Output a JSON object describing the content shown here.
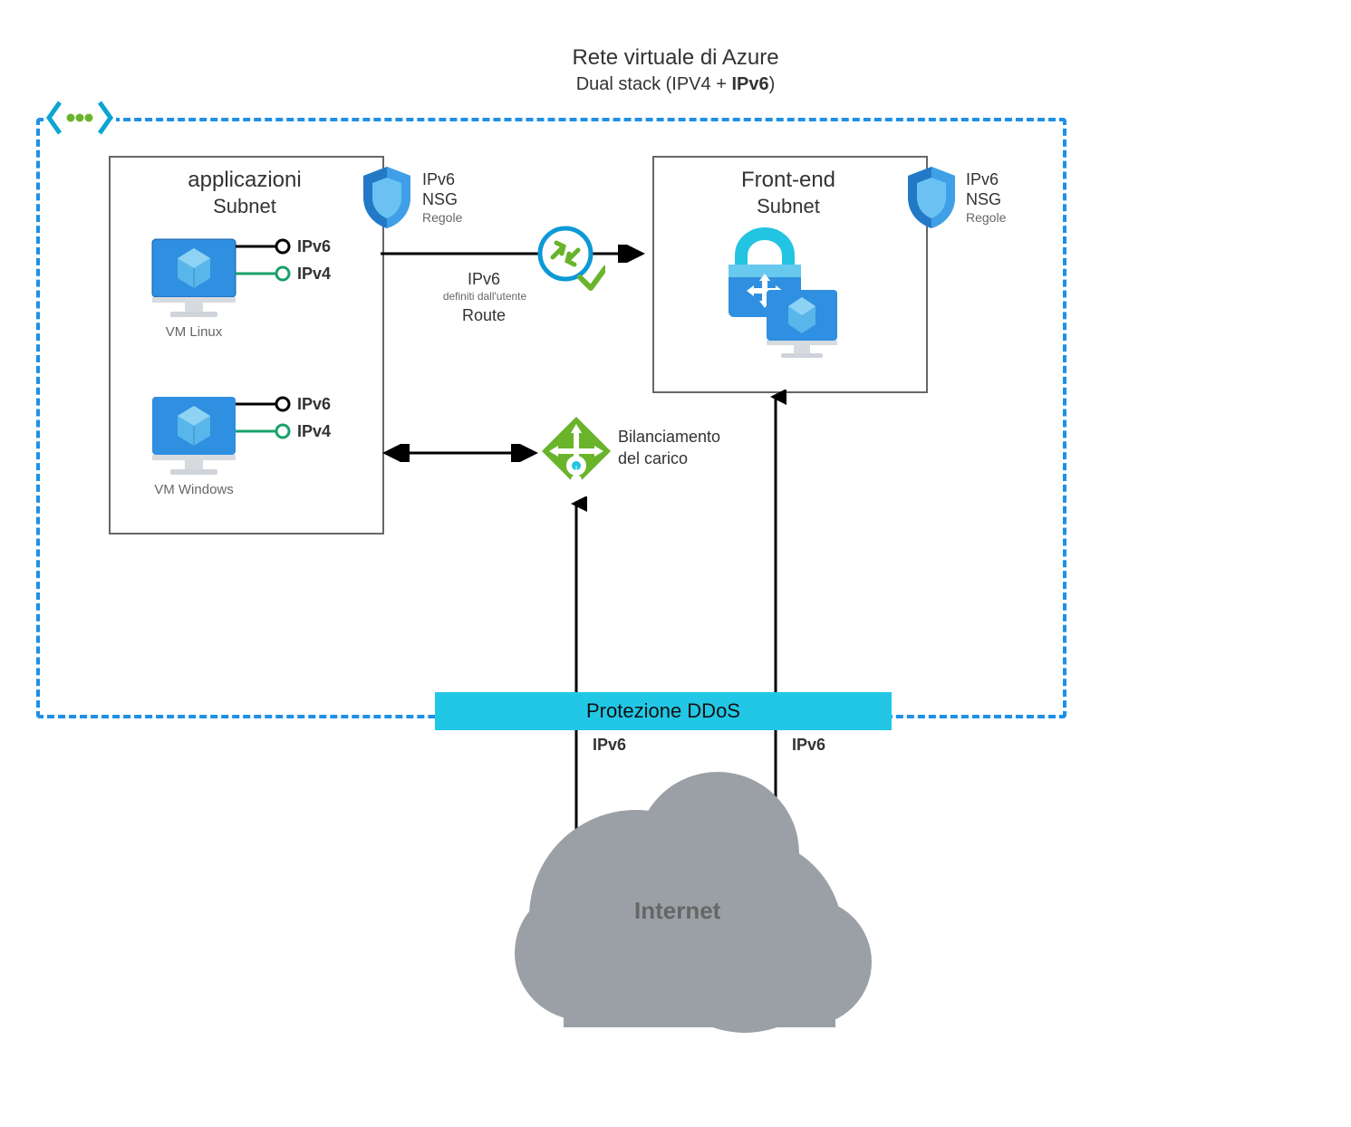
{
  "title": {
    "main": "Rete virtuale di Azure",
    "sub_prefix": "Dual stack (IPV4 + ",
    "sub_ipv6": "IPv6",
    "sub_suffix": ")"
  },
  "applications_subnet": {
    "title_line1": "applicazioni",
    "title_line2": "Subnet",
    "vm_linux": {
      "caption": "VM Linux",
      "ipv6": "IPv6",
      "ipv4": "IPv4"
    },
    "vm_windows": {
      "caption": "VM Windows",
      "ipv6": "IPv6",
      "ipv4": "IPv4"
    },
    "nsg": {
      "line1": "IPv6",
      "line2": "NSG",
      "line3": "Regole"
    }
  },
  "route": {
    "line1": "IPv6",
    "small": "definiti dall'utente",
    "line2": "Route"
  },
  "frontend_subnet": {
    "title_line1": "Front-end",
    "title_line2": "Subnet",
    "nsg": {
      "line1": "IPv6",
      "line2": "NSG",
      "line3": "Regole"
    }
  },
  "load_balancer": {
    "line1": "Bilanciamento",
    "line2": "del carico"
  },
  "ddos": "Protezione DDoS",
  "bottom": {
    "ipv6_left": "IPv6",
    "ipv6_right": "IPv6"
  },
  "internet": "Internet"
}
